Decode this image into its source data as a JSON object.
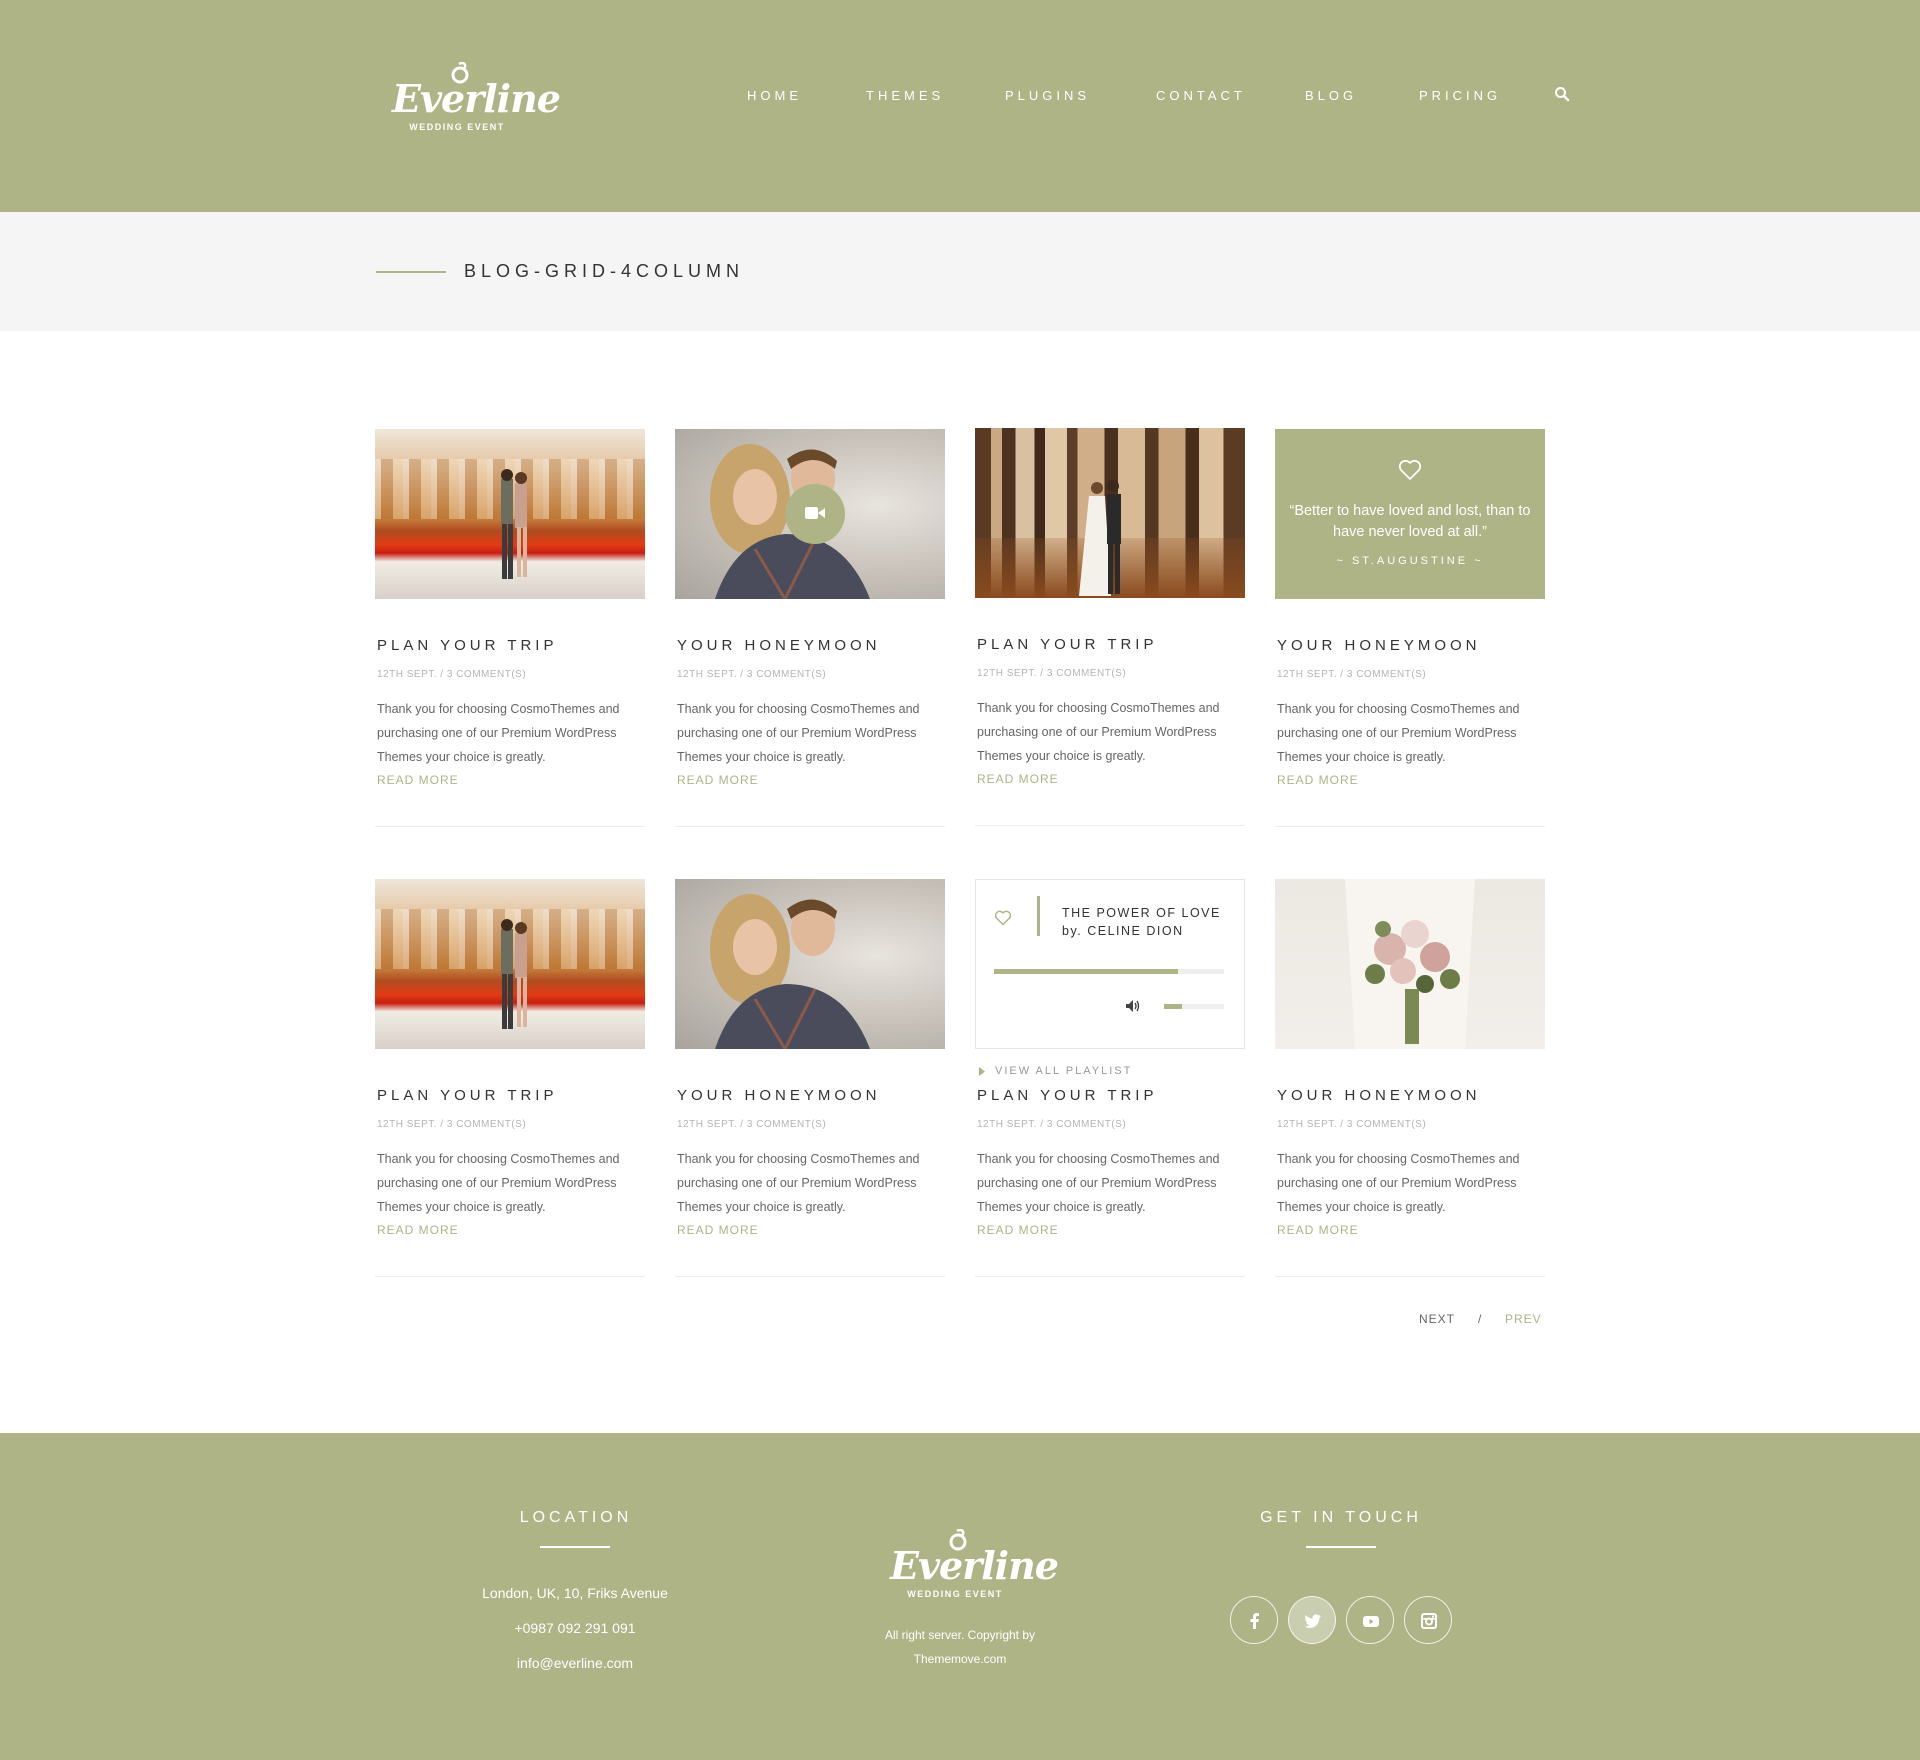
{
  "brand": {
    "name": "Everline",
    "tagline": "WEDDING EVENT"
  },
  "nav": [
    {
      "label": "HOME"
    },
    {
      "label": "THEMES"
    },
    {
      "label": "PLUGINS"
    },
    {
      "label": "CONTACT"
    },
    {
      "label": "BLOG"
    },
    {
      "label": "PRICING"
    }
  ],
  "page_title": "BLOG-GRID-4COLUMN",
  "posts": [
    {
      "title": "PLAN YOUR TRIP",
      "meta": "12TH SEPT. / 3 COMMENT(S)",
      "excerpt": "Thank you for choosing CosmoThemes and purchasing one of our Premium WordPress Themes your choice is greatly.",
      "more": "READ MORE",
      "media": "photo-couple-train"
    },
    {
      "title": "YOUR HONEYMOON",
      "meta": "12TH SEPT. / 3 COMMENT(S)",
      "excerpt": "Thank you for choosing CosmoThemes and purchasing one of our Premium WordPress Themes your choice is greatly.",
      "more": "READ MORE",
      "media": "video-couple"
    },
    {
      "title": "PLAN YOUR TRIP",
      "meta": "12TH SEPT. / 3 COMMENT(S)",
      "excerpt": "Thank you for choosing CosmoThemes and purchasing one of our Premium WordPress Themes your choice is greatly.",
      "more": "READ MORE",
      "media": "photo-forest-couple"
    },
    {
      "title": "YOUR HONEYMOON",
      "meta": "12TH SEPT. / 3 COMMENT(S)",
      "excerpt": "Thank you for choosing CosmoThemes and purchasing one of our Premium WordPress Themes your choice is greatly.",
      "more": "READ MORE",
      "media": "quote"
    },
    {
      "title": "PLAN YOUR TRIP",
      "meta": "12TH SEPT. / 3 COMMENT(S)",
      "excerpt": "Thank you for choosing CosmoThemes and purchasing one of our Premium WordPress Themes your choice is greatly.",
      "more": "READ MORE",
      "media": "photo-couple-train"
    },
    {
      "title": "YOUR HONEYMOON",
      "meta": "12TH SEPT. / 3 COMMENT(S)",
      "excerpt": "Thank you for choosing CosmoThemes and purchasing one of our Premium WordPress Themes your choice is greatly.",
      "more": "READ MORE",
      "media": "photo-couple"
    },
    {
      "title": "PLAN YOUR TRIP",
      "meta": "12TH SEPT. / 3 COMMENT(S)",
      "excerpt": "Thank you for choosing CosmoThemes and purchasing one of our Premium WordPress Themes your choice is greatly.",
      "more": "READ MORE",
      "media": "audio"
    },
    {
      "title": "YOUR HONEYMOON",
      "meta": "12TH SEPT. / 3 COMMENT(S)",
      "excerpt": "Thank you for choosing CosmoThemes and purchasing one of our Premium WordPress Themes your choice is greatly.",
      "more": "READ MORE",
      "media": "photo-bouquet"
    }
  ],
  "quote": {
    "text": "“Better to have loved and lost, than to have never loved at all.”",
    "author": "~ ST.AUGUSTINE ~"
  },
  "audio": {
    "line1": "THE POWER OF LOVE",
    "line2": "by. CELINE DION",
    "progress": 0.8,
    "volume": 0.3,
    "playlist_label": "VIEW ALL PLAYLIST"
  },
  "pagination": {
    "next": "NEXT",
    "separator": "/",
    "prev": "PREV"
  },
  "footer": {
    "location_title": "LOCATION",
    "address": "London, UK, 10, Friks Avenue",
    "phone": "+0987 092 291 091",
    "email": "info@everline.com",
    "copyright_line1": "All right server. Copyright by",
    "copyright_line2": "Thememove.com",
    "contact_title": "GET IN TOUCH",
    "social": [
      "facebook-icon",
      "twitter-icon",
      "youtube-icon",
      "instagram-icon"
    ]
  },
  "colors": {
    "accent": "#aeb486",
    "light_bg": "#f5f5f5",
    "text_dark": "#333333",
    "meta": "#b4b4b4"
  }
}
